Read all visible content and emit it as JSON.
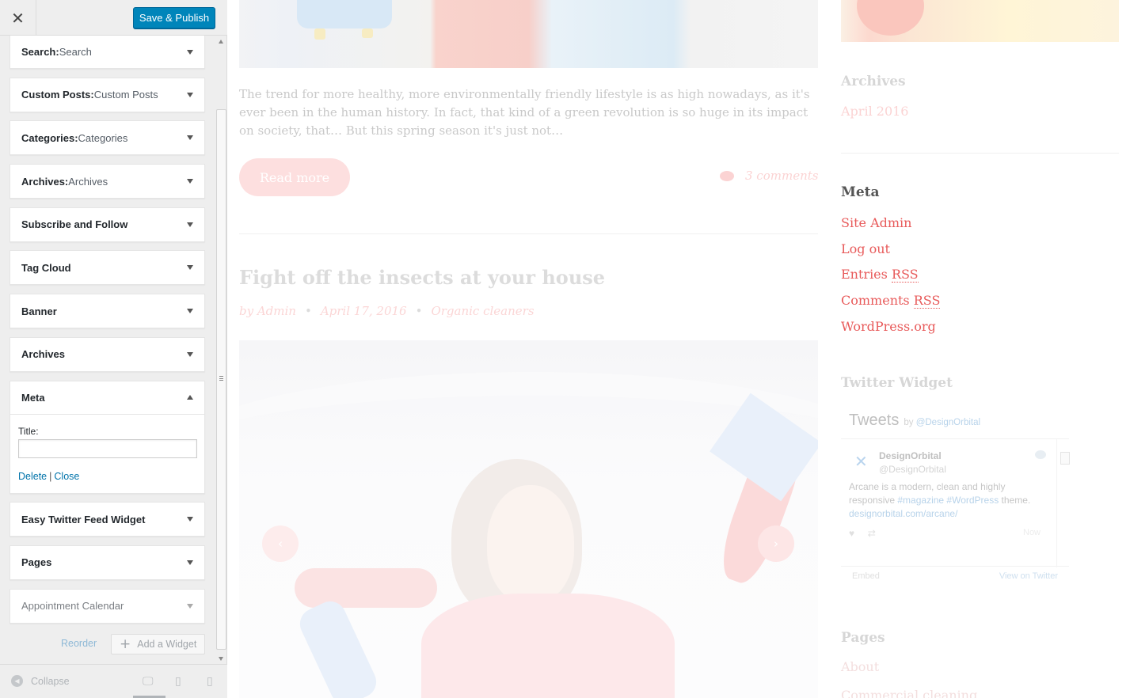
{
  "customizer": {
    "close_label": "✕",
    "publish_label": "Save & Publish",
    "widgets": [
      {
        "title": "Search:",
        "subtitle": " Search"
      },
      {
        "title": "Custom Posts:",
        "subtitle": " Custom Posts"
      },
      {
        "title": "Categories:",
        "subtitle": " Categories"
      },
      {
        "title": "Archives:",
        "subtitle": " Archives"
      },
      {
        "title": "Subscribe and Follow",
        "subtitle": ""
      },
      {
        "title": "Tag Cloud",
        "subtitle": ""
      },
      {
        "title": "Banner",
        "subtitle": ""
      },
      {
        "title": "Archives",
        "subtitle": ""
      }
    ],
    "open_widget": {
      "title": "Meta",
      "field_label": "Title:",
      "field_value": "",
      "delete_label": "Delete",
      "separator": "|",
      "close_label": "Close"
    },
    "widgets_after": [
      {
        "title": "Easy Twitter Feed Widget"
      },
      {
        "title": "Pages"
      },
      {
        "title": "Appointment Calendar"
      }
    ],
    "reorder_label": "Reorder",
    "add_widget_label": "Add a Widget",
    "collapse_label": "Collapse",
    "devices": {
      "desktop_icon": "desktop-icon",
      "tablet_icon": "tablet-icon",
      "mobile_icon": "mobile-icon"
    }
  },
  "preview": {
    "excerpt": "The trend for more healthy, more environmentally friendly lifestyle is as high nowadays, as it's ever been in the human history. In fact, that kind of a green revolution is so huge in its impact on society, that… But this spring season it's just not…",
    "read_more_label": "Read more",
    "comments_label": "3 comments",
    "post_title": "Fight off the insects at your house",
    "post_author": "by Admin",
    "post_date": "April 17, 2016",
    "post_category": "Organic cleaners",
    "dot": "•",
    "slider_prev": "‹",
    "slider_next": "›",
    "sidebar": {
      "archives_heading": "Archives",
      "archives_link": "April 2016",
      "meta_heading": "Meta",
      "meta_links": [
        "Site Admin",
        "Log out",
        "Entries ",
        "Comments ",
        "WordPress.org"
      ],
      "rss_abbr": "RSS",
      "twitter_heading": "Twitter Widget",
      "tweets_label": "Tweets",
      "tweets_by": "by ",
      "tweets_handle": "@DesignOrbital",
      "tweet_name": "DesignOrbital",
      "tweet_user": "@DesignOrbital",
      "tweet_text_1": "Arcane is a modern, clean and highly responsive ",
      "tweet_tags": "#magazine #WordPress",
      "tweet_text_2": " theme.",
      "tweet_link": "designorbital.com/arcane/",
      "tweet_time": "Now",
      "embed_label": "Embed",
      "view_on_twitter": "View on Twitter",
      "pages_heading": "Pages",
      "pages_link1": "About",
      "pages_link2": "Commercial cleaning"
    },
    "colors": {
      "accent": "#e85a5a",
      "publish": "#0085ba",
      "link": "#0073aa"
    }
  }
}
